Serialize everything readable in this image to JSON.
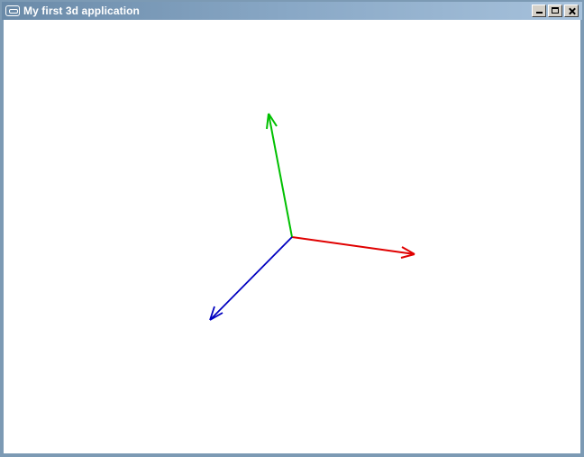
{
  "window": {
    "title": "My first 3d application",
    "controls": [
      "minimize",
      "maximize",
      "close"
    ],
    "icon": "app-icon"
  },
  "scene": {
    "background": "#ffffff",
    "axes": [
      {
        "name": "x-axis",
        "color": "#e00000"
      },
      {
        "name": "y-axis",
        "color": "#00c000"
      },
      {
        "name": "z-axis",
        "color": "#0000c0"
      }
    ]
  }
}
